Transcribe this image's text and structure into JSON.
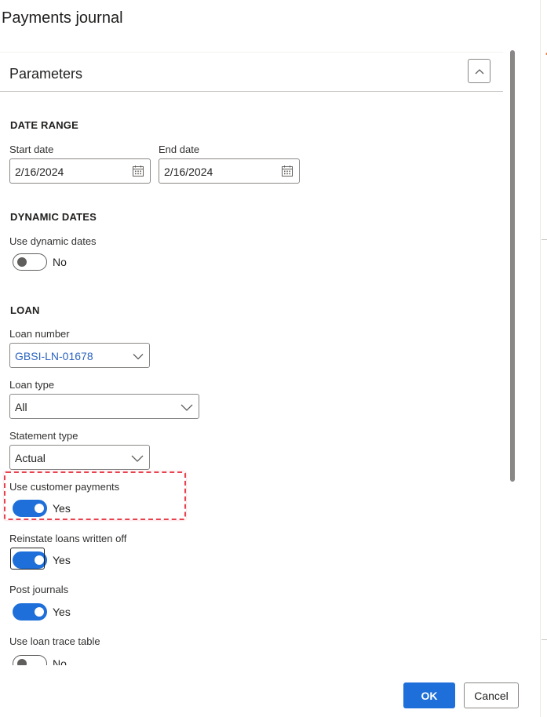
{
  "dialog": {
    "title": "Payments journal"
  },
  "section": {
    "title": "Parameters"
  },
  "date_range": {
    "title": "DATE RANGE",
    "start_label": "Start date",
    "start_value": "2/16/2024",
    "end_label": "End date",
    "end_value": "2/16/2024"
  },
  "dynamic_dates": {
    "title": "DYNAMIC DATES",
    "use_label": "Use dynamic dates",
    "use_value": "No",
    "use_on": false
  },
  "loan": {
    "title": "LOAN",
    "number_label": "Loan number",
    "number_value": "GBSI-LN-01678",
    "type_label": "Loan type",
    "type_value": "All",
    "statement_label": "Statement type",
    "statement_value": "Actual",
    "customer_payments_label": "Use customer payments",
    "customer_payments_value": "Yes",
    "customer_payments_on": true,
    "reinstate_label": "Reinstate loans written off",
    "reinstate_value": "Yes",
    "reinstate_on": true,
    "post_label": "Post journals",
    "post_value": "Yes",
    "post_on": true,
    "trace_label": "Use loan trace table",
    "trace_value": "No",
    "trace_on": false
  },
  "buttons": {
    "ok": "OK",
    "cancel": "Cancel"
  },
  "icons": {
    "collapse": "chevron-up-icon",
    "calendar": "calendar-icon",
    "dropdown": "chevron-down-icon"
  },
  "colors": {
    "accent": "#1e6fd9",
    "link": "#2b63c2",
    "highlight": "#e8424f"
  }
}
